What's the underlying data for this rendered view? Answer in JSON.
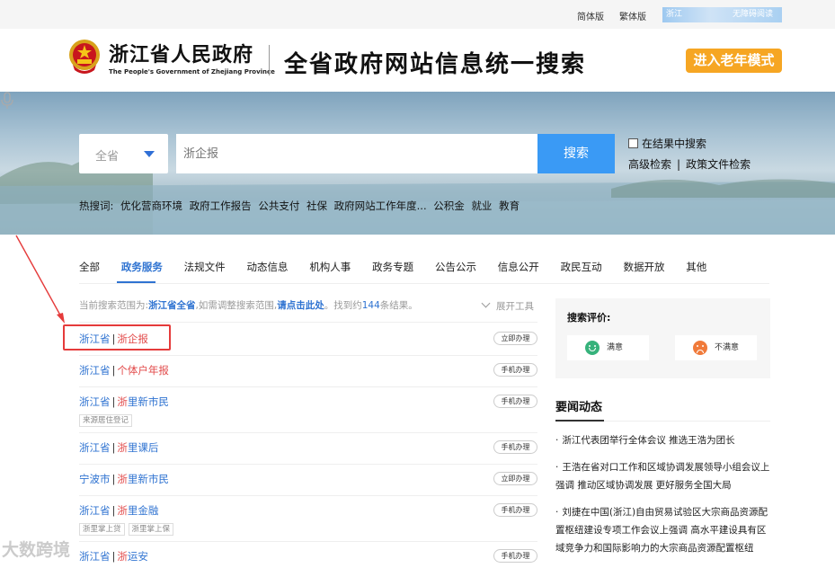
{
  "topbar": {
    "simplified": "简体版",
    "traditional": "繁体版",
    "user_left": "浙江",
    "user_right": "无障碍阅读"
  },
  "header": {
    "brand_cn": "浙江省人民政府",
    "brand_en": "The People's Government of Zhejiang Province",
    "site_title": "全省政府网站信息统一搜索",
    "elder_mode": "进入老年模式"
  },
  "search": {
    "scope": "全省",
    "placeholder": "浙企报",
    "button": "搜索",
    "in_results": "在结果中搜索",
    "advanced": "高级检索",
    "policy": "政策文件检索",
    "hot_label": "热搜词:",
    "hotwords": [
      "优化营商环境",
      "政府工作报告",
      "公共支付",
      "社保",
      "政府网站工作年度...",
      "公积金",
      "就业",
      "教育"
    ]
  },
  "tabs": [
    "全部",
    "政务服务",
    "法规文件",
    "动态信息",
    "机构人事",
    "政务专题",
    "公告公示",
    "信息公开",
    "政民互动",
    "数据开放",
    "其他"
  ],
  "active_tab": "政务服务",
  "result_info": {
    "prefix": "当前搜索范围为:",
    "scope": "浙江省全省",
    "mid": ",如需调整搜索范围,",
    "link": "请点击此处",
    "found": "。找到约",
    "count": "144",
    "suffix": "条结果。",
    "expand": "展开工具"
  },
  "results": [
    {
      "region": "浙江省",
      "service_red": "浙企报",
      "service_blue": "",
      "button": "立即办理",
      "tags": []
    },
    {
      "region": "浙江省",
      "service_red": "个体户年报",
      "service_blue": "",
      "button": "手机办理",
      "tags": []
    },
    {
      "region": "浙江省",
      "service_red": "浙",
      "service_blue": "里新市民",
      "button": "手机办理",
      "tags": [
        "来源居住登记"
      ]
    },
    {
      "region": "浙江省",
      "service_red": "浙",
      "service_blue": "里课后",
      "button": "手机办理",
      "tags": []
    },
    {
      "region": "宁波市",
      "service_red": "浙",
      "service_blue": "里新市民",
      "button": "立即办理",
      "tags": []
    },
    {
      "region": "浙江省",
      "service_red": "浙",
      "service_blue": "里金融",
      "button": "手机办理",
      "tags": [
        "浙里掌上贷",
        "浙里掌上保"
      ]
    },
    {
      "region": "浙江省",
      "service_red": "浙",
      "service_blue": "运安",
      "button": "手机办理",
      "tags": []
    }
  ],
  "evaluation": {
    "title": "搜索评价:",
    "good": "满意",
    "bad": "不满意"
  },
  "news": {
    "title": "要闻动态",
    "items": [
      "浙江代表团举行全体会议 推选王浩为团长",
      "王浩在省对口工作和区域协调发展领导小组会议上强调 推动区域协调发展 更好服务全国大局",
      "刘捷在中国(浙江)自由贸易试验区大宗商品资源配置枢纽建设专项工作会议上强调 高水平建设具有区域竞争力和国际影响力的大宗商品资源配置枢纽"
    ]
  },
  "watermark": "大数跨境",
  "colors": {
    "accent": "#2f73d1",
    "search_btn": "#3a9af5",
    "elder_btn": "#f6a623",
    "highlight": "#e53b3b"
  }
}
